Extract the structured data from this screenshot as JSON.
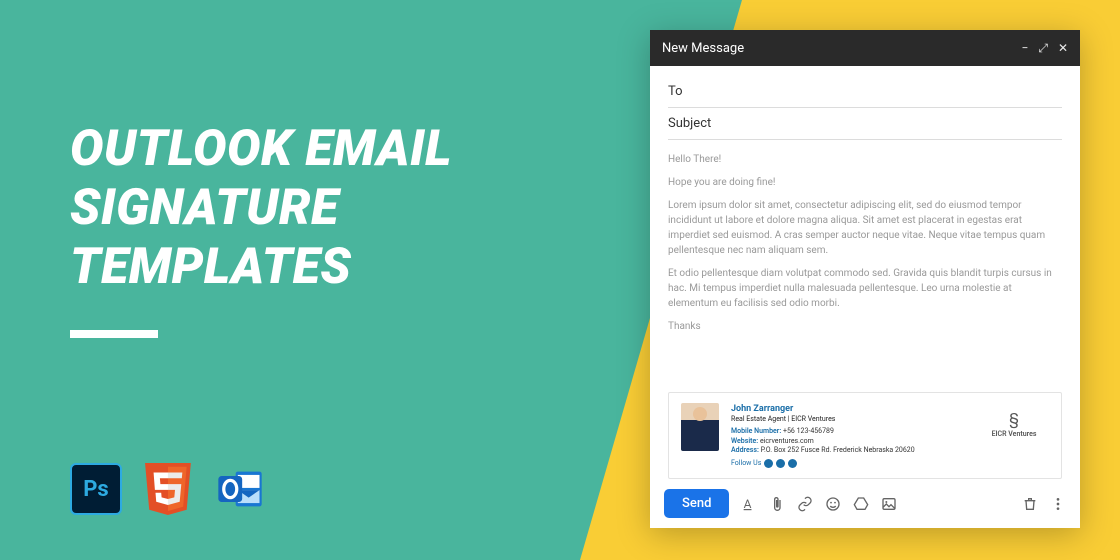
{
  "headline": {
    "l1": "OUTLOOK EMAIL",
    "l2": "SIGNATURE",
    "l3": "TEMPLATES"
  },
  "icons": {
    "ps": "Ps"
  },
  "compose": {
    "title": "New Message",
    "to_label": "To",
    "subject_label": "Subject",
    "body": {
      "greeting": "Hello There!",
      "l1": "Hope you are doing fine!",
      "p1": "Lorem ipsum dolor sit amet, consectetur adipiscing elit, sed do eiusmod tempor incididunt ut labore et dolore magna aliqua. Sit amet est placerat in egestas erat imperdiet sed euismod. A cras semper auctor neque vitae. Neque vitae tempus quam pellentesque nec nam aliquam sem.",
      "p2": "Et odio pellentesque diam volutpat commodo sed. Gravida quis blandit turpis cursus in hac. Mi tempus imperdiet nulla malesuada pellentesque. Leo urna molestie at elementum eu facilisis sed odio morbi.",
      "closing": "Thanks"
    },
    "signature": {
      "name": "John Zarranger",
      "title": "Real Estate Agent | EICR Ventures",
      "mobile_k": "Mobile Number:",
      "mobile_v": "+56 123-456789",
      "site_k": "Website:",
      "site_v": "eicrventures.com",
      "addr_k": "Address:",
      "addr_v": "P.O. Box 252 Fusce Rd. Frederick Nebraska 20620",
      "follow": "Follow Us",
      "logo_name": "EICR Ventures"
    },
    "send": "Send"
  }
}
